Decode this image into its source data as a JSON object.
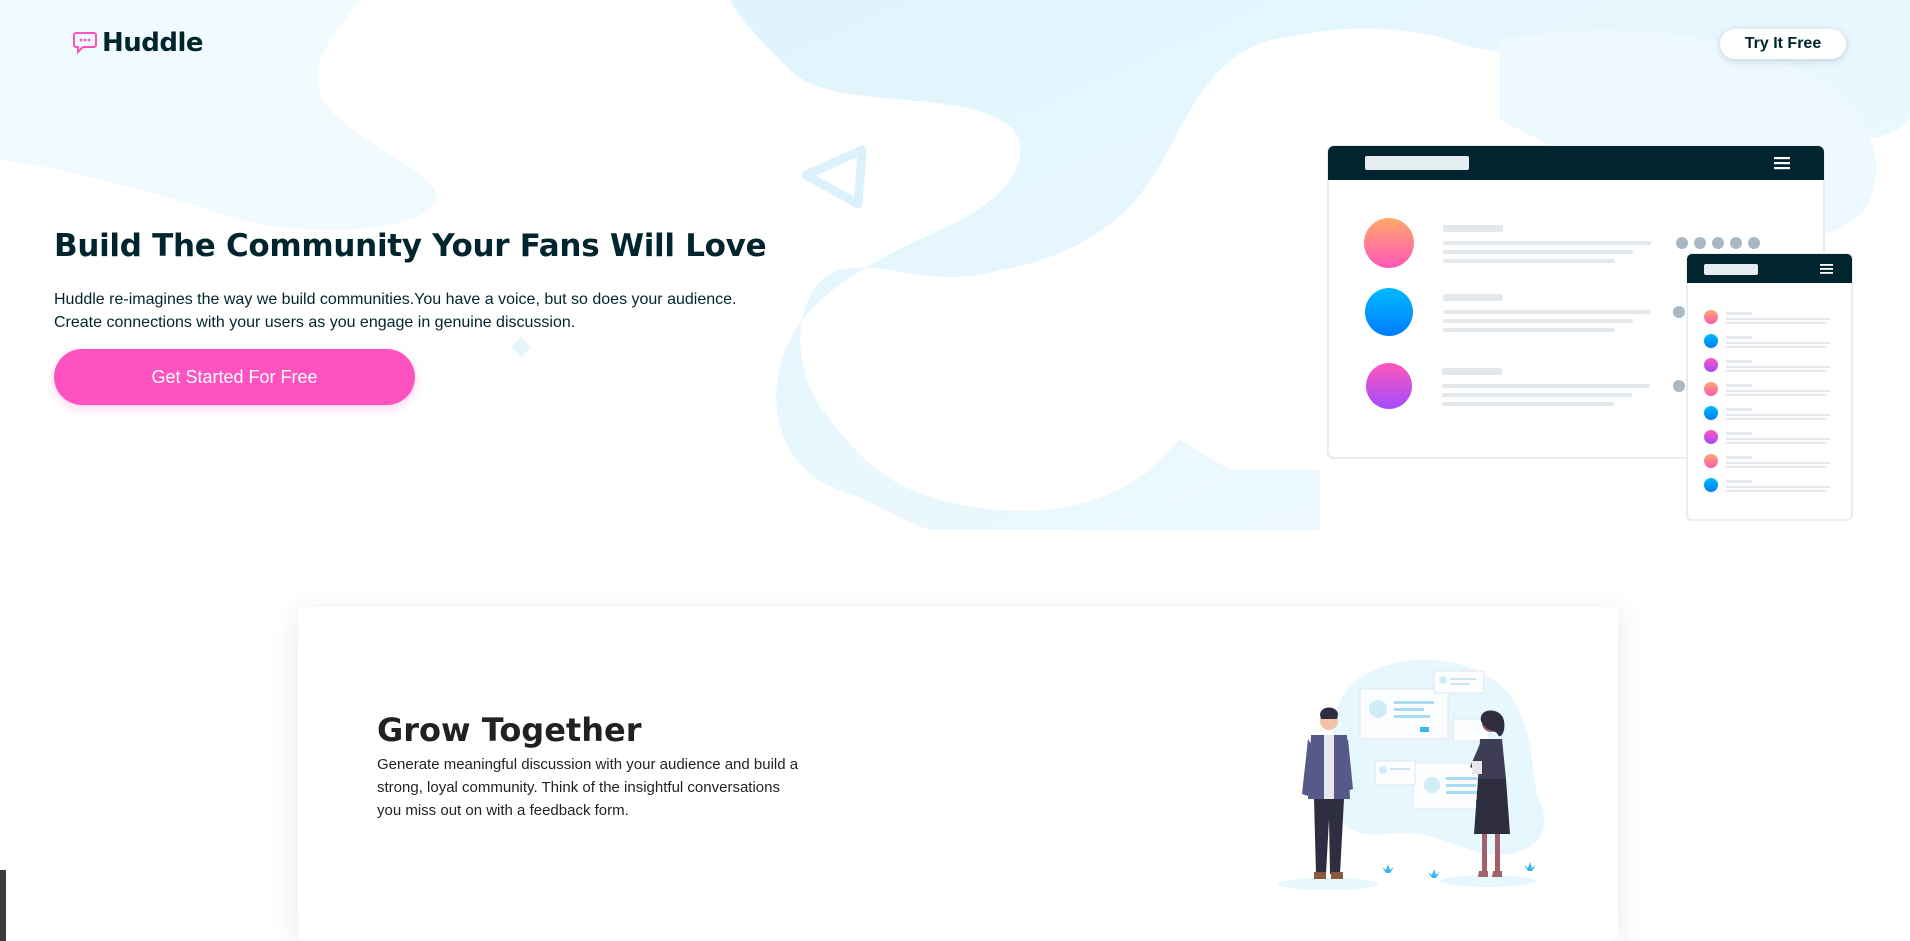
{
  "header": {
    "brand": "Huddle",
    "try_label": "Try It Free"
  },
  "hero": {
    "title": "Build The Community Your Fans Will Love",
    "desc_line1": "Huddle re-imagines the way we build communities.You have a voice, but so does your audience.",
    "desc_line2": "Create connections with your users as you engage in genuine discussion.",
    "cta_label": "Get Started For Free"
  },
  "feature": {
    "title": "Grow Together",
    "desc": "Generate meaningful discussion with your audience and build a strong, loyal community. Think of the insightful conversations you miss out on with a feedback form."
  },
  "colors": {
    "brand_dark": "#00252e",
    "accent_pink": "#ff52c1",
    "bg_blue": "#e6f8ff"
  },
  "icons": {
    "logo": "chat-bubble-icon",
    "menu": "hamburger-icon"
  }
}
